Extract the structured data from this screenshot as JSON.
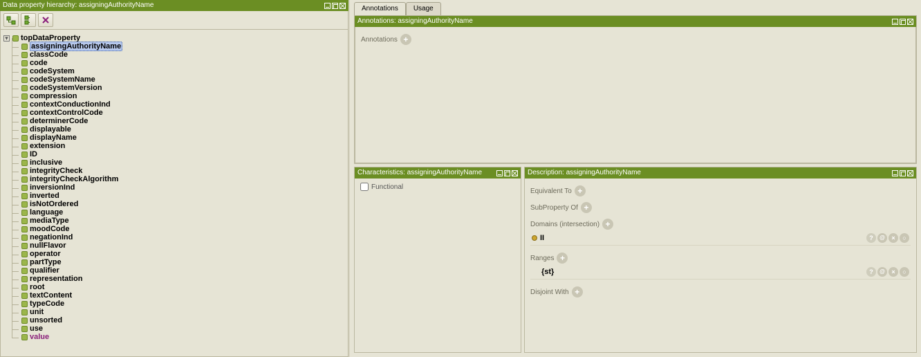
{
  "left": {
    "title": "Data property hierarchy: assigningAuthorityName",
    "root_label": "topDataProperty",
    "items": [
      {
        "label": "assigningAuthorityName",
        "selected": true
      },
      {
        "label": "classCode"
      },
      {
        "label": "code"
      },
      {
        "label": "codeSystem"
      },
      {
        "label": "codeSystemName"
      },
      {
        "label": "codeSystemVersion"
      },
      {
        "label": "compression"
      },
      {
        "label": "contextConductionInd"
      },
      {
        "label": "contextControlCode"
      },
      {
        "label": "determinerCode"
      },
      {
        "label": "displayable"
      },
      {
        "label": "displayName"
      },
      {
        "label": "extension"
      },
      {
        "label": "ID"
      },
      {
        "label": "inclusive"
      },
      {
        "label": "integrityCheck"
      },
      {
        "label": "integrityCheckAlgorithm"
      },
      {
        "label": "inversionInd"
      },
      {
        "label": "inverted"
      },
      {
        "label": "isNotOrdered"
      },
      {
        "label": "language"
      },
      {
        "label": "mediaType"
      },
      {
        "label": "moodCode"
      },
      {
        "label": "negationInd"
      },
      {
        "label": "nullFlavor"
      },
      {
        "label": "operator"
      },
      {
        "label": "partType"
      },
      {
        "label": "qualifier"
      },
      {
        "label": "representation"
      },
      {
        "label": "root"
      },
      {
        "label": "textContent"
      },
      {
        "label": "typeCode"
      },
      {
        "label": "unit"
      },
      {
        "label": "unsorted"
      },
      {
        "label": "use"
      },
      {
        "label": "value",
        "style": "value"
      }
    ]
  },
  "tabs": {
    "annotations": "Annotations",
    "usage": "Usage"
  },
  "annotations_panel": {
    "title": "Annotations: assigningAuthorityName",
    "section": "Annotations"
  },
  "char_panel": {
    "title": "Characteristics: assigningAuthorityName",
    "functional_label": "Functional"
  },
  "desc_panel": {
    "title": "Description: assigningAuthorityName",
    "equiv": "Equivalent To",
    "subprop": "SubProperty Of",
    "domains": "Domains (intersection)",
    "domain_val": "II",
    "ranges": "Ranges",
    "range_val": "{st}",
    "disjoint": "Disjoint With"
  }
}
